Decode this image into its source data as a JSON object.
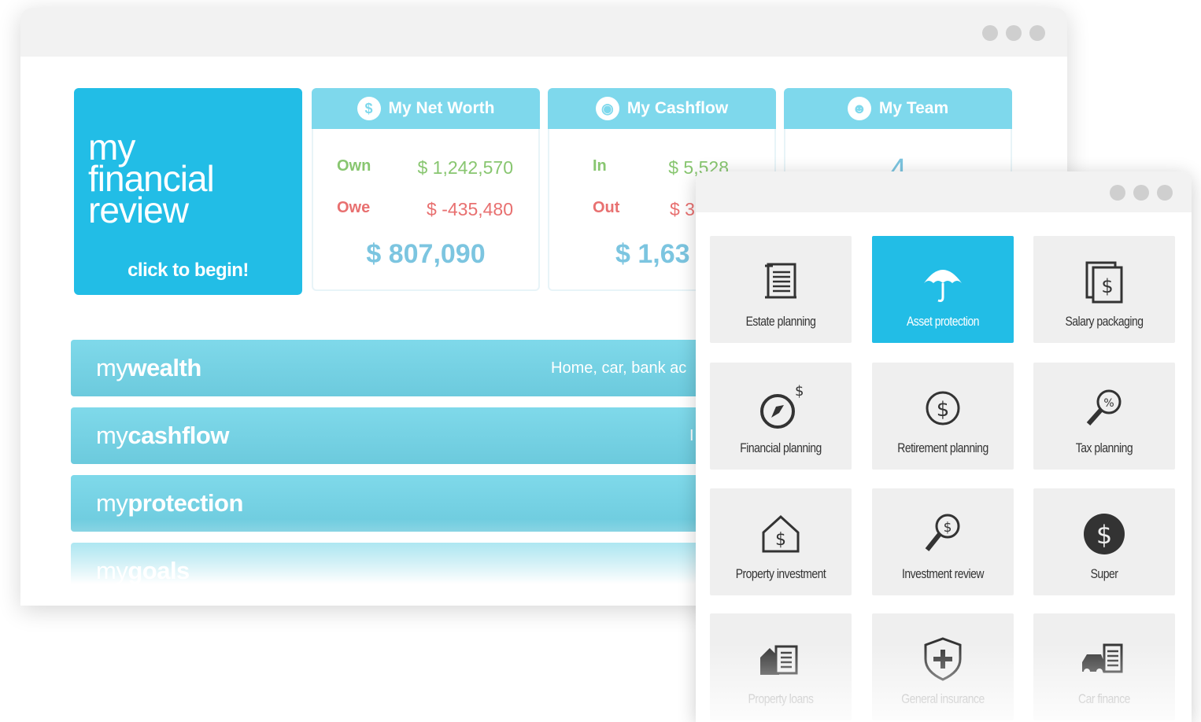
{
  "back_window": {
    "hero": {
      "title": "my\nfinancial\nreview",
      "cta": "click to begin!"
    },
    "cards": {
      "net_worth": {
        "title": "My Net Worth",
        "icon": "dollar-icon",
        "own_label": "Own",
        "own_value": "$ 1,242,570",
        "owe_label": "Owe",
        "owe_value": "$ -435,480",
        "total": "$ 807,090"
      },
      "cashflow": {
        "title": "My Cashflow",
        "icon": "camera-icon",
        "in_label": "In",
        "in_value": "$ 5,528",
        "out_label": "Out",
        "out_value": "$ 3",
        "total": "$ 1,63"
      },
      "team": {
        "title": "My Team",
        "icon": "team-icon",
        "count": "4"
      }
    },
    "bars": [
      {
        "prefix": "my",
        "bold": "wealth",
        "subtitle": "Home, car, bank ac"
      },
      {
        "prefix": "my",
        "bold": "cashflow",
        "subtitle": "I"
      },
      {
        "prefix": "my",
        "bold": "protection",
        "subtitle": ""
      },
      {
        "prefix": "my",
        "bold": "goals",
        "subtitle": ""
      }
    ]
  },
  "front_window": {
    "tiles": [
      {
        "label": "Estate planning",
        "icon": "scroll-icon"
      },
      {
        "label": "Asset protection",
        "icon": "umbrella-icon"
      },
      {
        "label": "Salary packaging",
        "icon": "stacked-dollar-icon"
      },
      {
        "label": "Financial planning",
        "icon": "compass-icon"
      },
      {
        "label": "Retirement planning",
        "icon": "dollar-coin-icon"
      },
      {
        "label": "Tax planning",
        "icon": "percent-magnifier-icon"
      },
      {
        "label": "Property investment",
        "icon": "house-dollar-icon"
      },
      {
        "label": "Investment review",
        "icon": "dollar-magnifier-icon"
      },
      {
        "label": "Super",
        "icon": "dollar-circle-icon"
      },
      {
        "label": "Property loans",
        "icon": "house-document-icon"
      },
      {
        "label": "General insurance",
        "icon": "shield-plus-icon"
      },
      {
        "label": "Car finance",
        "icon": "car-document-icon"
      }
    ]
  },
  "colors": {
    "accent": "#22bde6",
    "card_header": "#7ed8ec",
    "own": "#88c670",
    "owe": "#e87070",
    "total": "#7cc5e0"
  }
}
